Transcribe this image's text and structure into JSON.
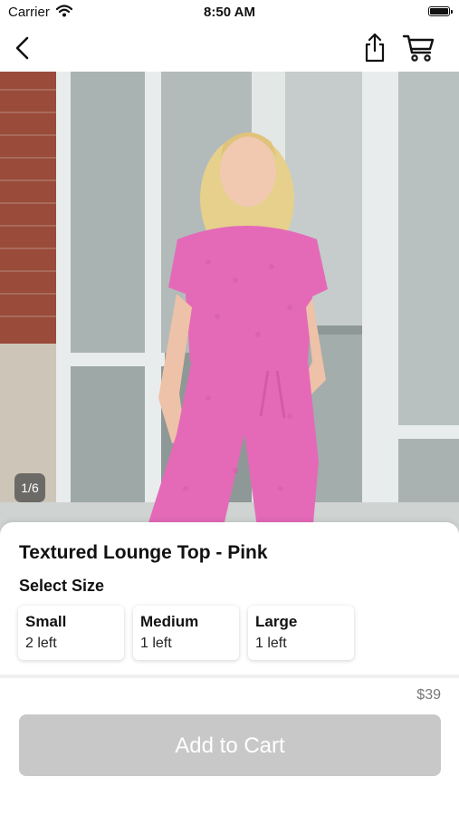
{
  "status_bar": {
    "carrier": "Carrier",
    "time": "8:50 AM"
  },
  "nav": {
    "back_icon": "chevron-left-icon",
    "share_icon": "share-icon",
    "cart_icon": "cart-icon"
  },
  "hero": {
    "image_counter": "1/6"
  },
  "product": {
    "title": "Textured Lounge Top - Pink",
    "size_heading": "Select Size",
    "sizes": [
      {
        "name": "Small",
        "stock": "2 left"
      },
      {
        "name": "Medium",
        "stock": "1 left"
      },
      {
        "name": "Large",
        "stock": "1 left"
      }
    ],
    "price": "$39",
    "add_to_cart": "Add to Cart"
  },
  "colors": {
    "top_pink": "#e46ab8",
    "button_disabled": "#c8c8c8"
  }
}
